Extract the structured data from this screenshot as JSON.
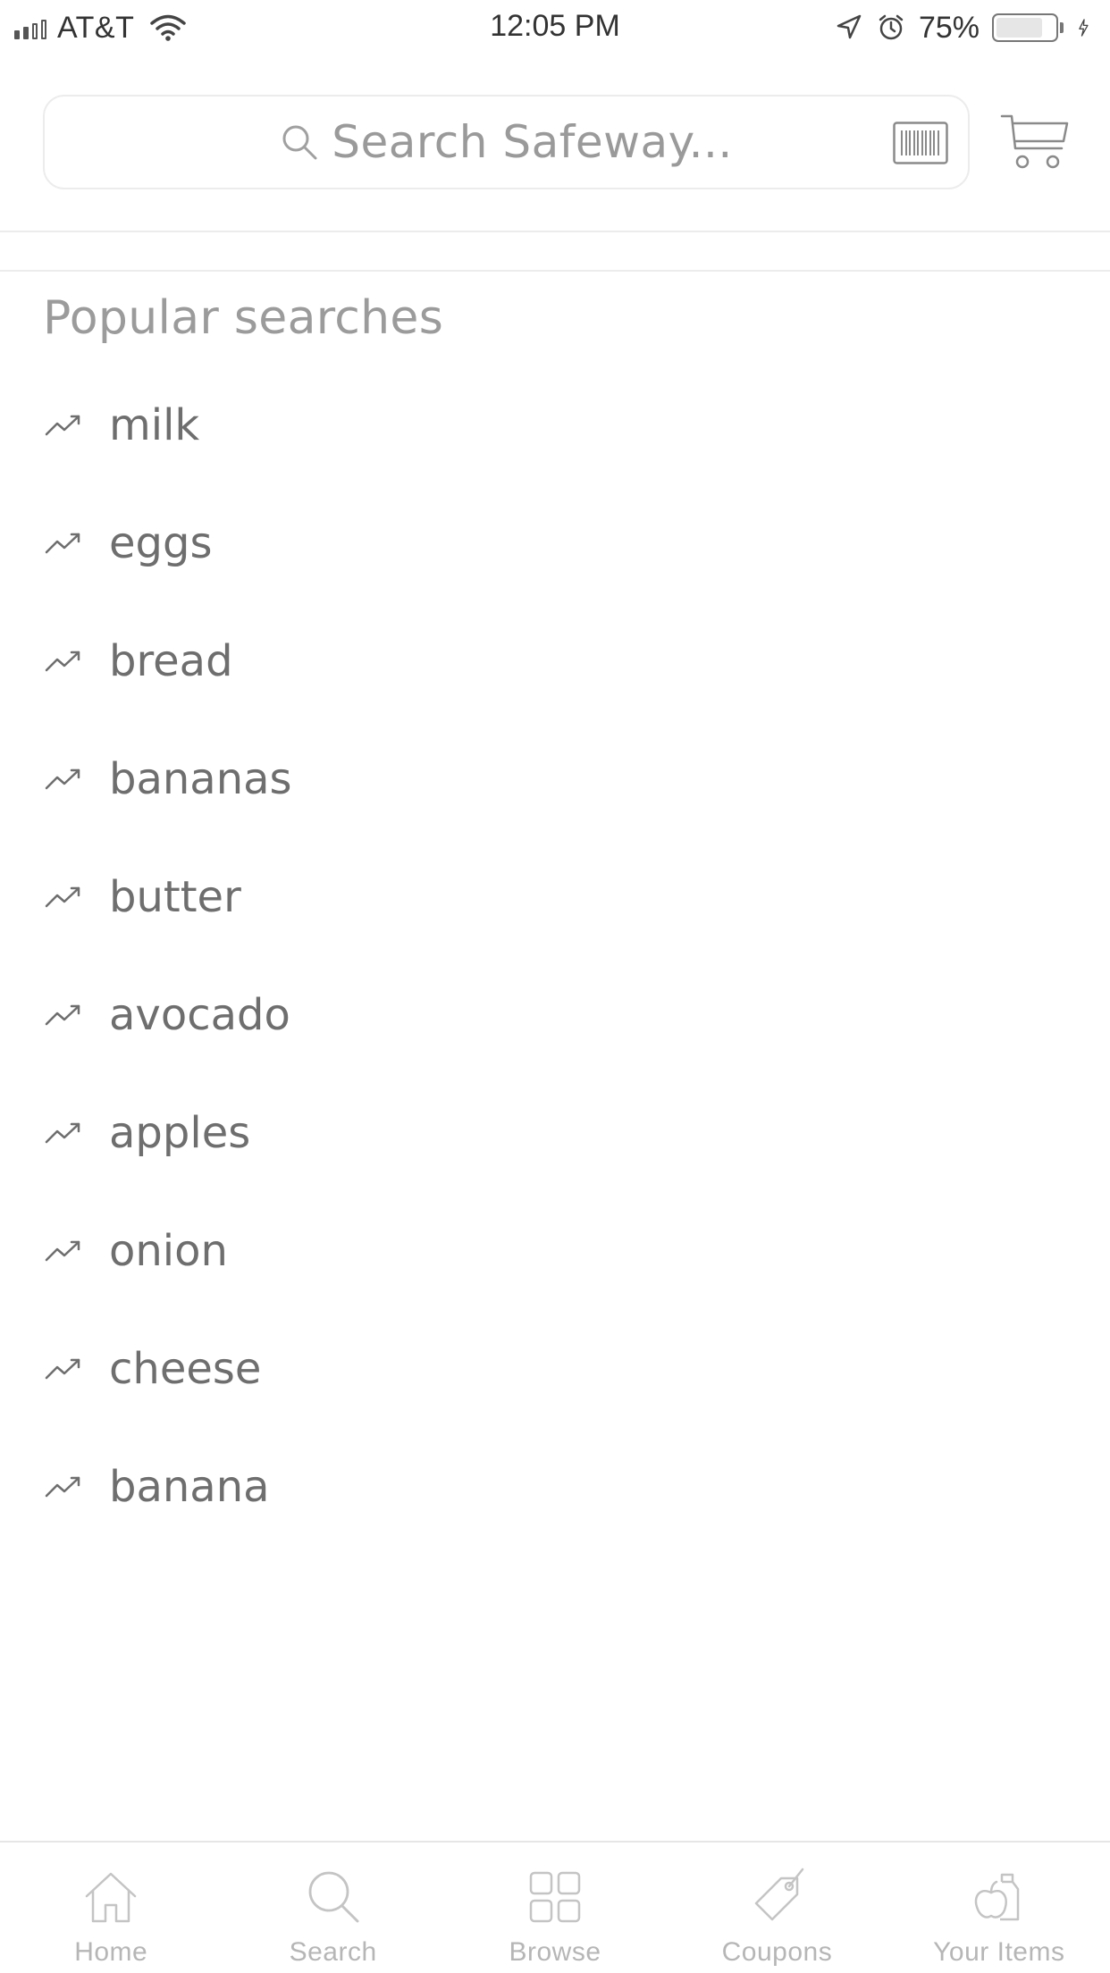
{
  "status_bar": {
    "carrier": "AT&T",
    "time": "12:05 PM",
    "battery_percent": "75%",
    "battery_level": 0.75,
    "signal_bars": 2,
    "icons": [
      "signal-icon",
      "wifi-icon",
      "location-arrow-icon",
      "alarm-icon",
      "battery-icon",
      "charging-bolt-icon"
    ]
  },
  "header": {
    "search_placeholder": "Search Safeway...",
    "search_icon": "search-icon",
    "barcode_icon": "barcode-scan-icon",
    "cart_icon": "cart-icon"
  },
  "popular": {
    "title": "Popular searches",
    "icon": "trending-up-icon",
    "items": [
      "milk",
      "eggs",
      "bread",
      "bananas",
      "butter",
      "avocado",
      "apples",
      "onion",
      "cheese",
      "banana"
    ]
  },
  "tab_bar": {
    "tabs": [
      {
        "label": "Home",
        "icon": "home-icon"
      },
      {
        "label": "Search",
        "icon": "search-icon"
      },
      {
        "label": "Browse",
        "icon": "grid-icon"
      },
      {
        "label": "Coupons",
        "icon": "tag-icon"
      },
      {
        "label": "Your Items",
        "icon": "items-bag-icon"
      }
    ]
  },
  "colors": {
    "text_primary": "#6e6e6e",
    "text_muted": "#9b9b9b",
    "tab_inactive": "#b6b6b6",
    "divider": "#ececec"
  }
}
